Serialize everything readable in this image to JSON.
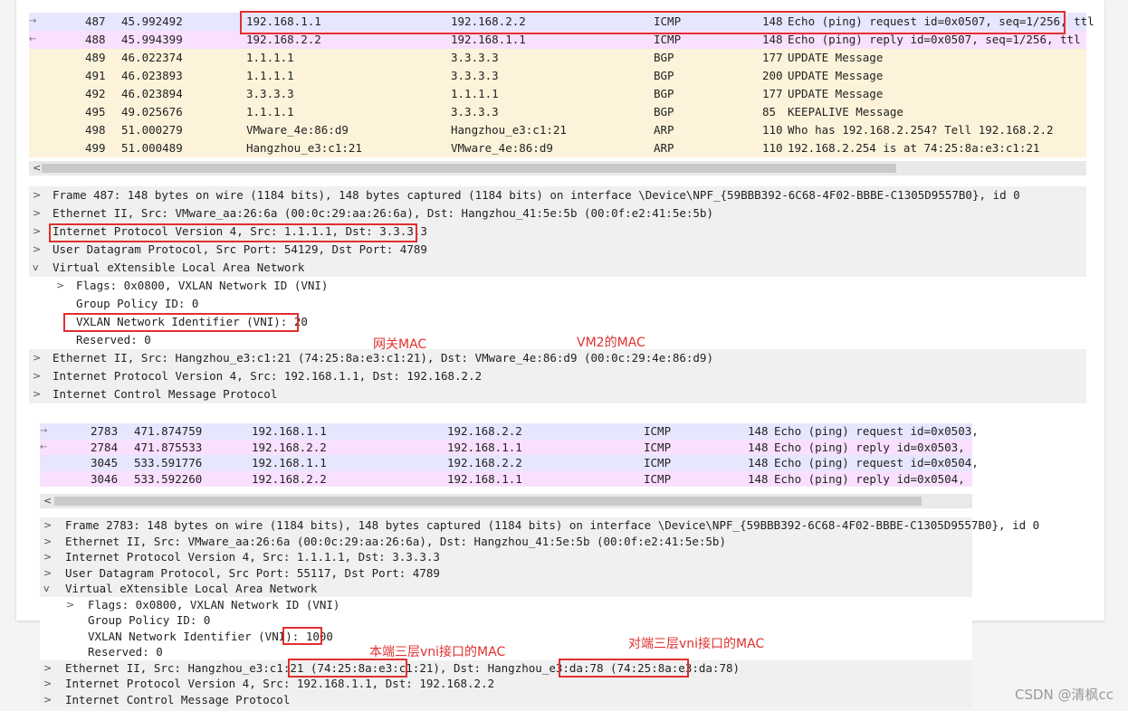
{
  "colors": {
    "icmp_row": "#e7e6ff",
    "icmp_reply_row": "#fae0ff",
    "bgp_row": "#fdf3da",
    "arp_row": "#fdf3da",
    "annotation": "#e03030"
  },
  "top": {
    "packets": [
      {
        "no": "487",
        "time": "45.992492",
        "src": "192.168.1.1",
        "dst": "192.168.2.2",
        "proto": "ICMP",
        "len": "148",
        "info": "Echo (ping) request  id=0x0507, seq=1/256, ttl",
        "arrow": "→"
      },
      {
        "no": "488",
        "time": "45.994399",
        "src": "192.168.2.2",
        "dst": "192.168.1.1",
        "proto": "ICMP",
        "len": "148",
        "info": "Echo (ping) reply    id=0x0507, seq=1/256, ttl",
        "arrow": "←"
      },
      {
        "no": "489",
        "time": "46.022374",
        "src": "1.1.1.1",
        "dst": "3.3.3.3",
        "proto": "BGP",
        "len": "177",
        "info": "UPDATE Message",
        "arrow": ""
      },
      {
        "no": "491",
        "time": "46.023893",
        "src": "1.1.1.1",
        "dst": "3.3.3.3",
        "proto": "BGP",
        "len": "200",
        "info": "UPDATE Message",
        "arrow": ""
      },
      {
        "no": "492",
        "time": "46.023894",
        "src": "3.3.3.3",
        "dst": "1.1.1.1",
        "proto": "BGP",
        "len": "177",
        "info": "UPDATE Message",
        "arrow": ""
      },
      {
        "no": "495",
        "time": "49.025676",
        "src": "1.1.1.1",
        "dst": "3.3.3.3",
        "proto": "BGP",
        "len": "85",
        "info": "KEEPALIVE Message",
        "arrow": ""
      },
      {
        "no": "498",
        "time": "51.000279",
        "src": "VMware_4e:86:d9",
        "dst": "Hangzhou_e3:c1:21",
        "proto": "ARP",
        "len": "110",
        "info": "Who has 192.168.2.254? Tell 192.168.2.2",
        "arrow": ""
      },
      {
        "no": "499",
        "time": "51.000489",
        "src": "Hangzhou_e3:c1:21",
        "dst": "VMware_4e:86:d9",
        "proto": "ARP",
        "len": "110",
        "info": "192.168.2.254 is at 74:25:8a:e3:c1:21",
        "arrow": ""
      }
    ],
    "scroll_left": "<",
    "details": [
      {
        "toggle": ">",
        "indent": 0,
        "text": "Frame 487: 148 bytes on wire (1184 bits), 148 bytes captured (1184 bits) on interface \\Device\\NPF_{59BBB392-6C68-4F02-BBBE-C1305D9557B0}, id 0"
      },
      {
        "toggle": ">",
        "indent": 0,
        "text": "Ethernet II, Src: VMware_aa:26:6a (00:0c:29:aa:26:6a), Dst: Hangzhou_41:5e:5b (00:0f:e2:41:5e:5b)"
      },
      {
        "toggle": ">",
        "indent": 0,
        "text": "Internet Protocol Version 4, Src: 1.1.1.1, Dst: 3.3.3.3"
      },
      {
        "toggle": ">",
        "indent": 0,
        "text": "User Datagram Protocol, Src Port: 54129, Dst Port: 4789"
      },
      {
        "toggle": "v",
        "indent": 0,
        "text": "Virtual eXtensible Local Area Network"
      },
      {
        "toggle": ">",
        "indent": 1,
        "text": "Flags: 0x0800, VXLAN Network ID (VNI)"
      },
      {
        "toggle": "",
        "indent": 1,
        "text": "Group Policy ID: 0"
      },
      {
        "toggle": "",
        "indent": 1,
        "text": "VXLAN Network Identifier (VNI): 20"
      },
      {
        "toggle": "",
        "indent": 1,
        "text": "Reserved: 0"
      },
      {
        "toggle": ">",
        "indent": 0,
        "text": "Ethernet II, Src: Hangzhou_e3:c1:21 (74:25:8a:e3:c1:21), Dst: VMware_4e:86:d9 (00:0c:29:4e:86:d9)"
      },
      {
        "toggle": ">",
        "indent": 0,
        "text": "Internet Protocol Version 4, Src: 192.168.1.1, Dst: 192.168.2.2"
      },
      {
        "toggle": ">",
        "indent": 0,
        "text": "Internet Control Message Protocol"
      }
    ],
    "notes": {
      "gateway_mac": "网关MAC",
      "vm2_mac": "VM2的MAC"
    }
  },
  "bottom": {
    "packets": [
      {
        "no": "2783",
        "time": "471.874759",
        "src": "192.168.1.1",
        "dst": "192.168.2.2",
        "proto": "ICMP",
        "len": "148",
        "info": "Echo (ping) request  id=0x0503,",
        "arrow": "→"
      },
      {
        "no": "2784",
        "time": "471.875533",
        "src": "192.168.2.2",
        "dst": "192.168.1.1",
        "proto": "ICMP",
        "len": "148",
        "info": "Echo (ping) reply    id=0x0503,",
        "arrow": "←"
      },
      {
        "no": "3045",
        "time": "533.591776",
        "src": "192.168.1.1",
        "dst": "192.168.2.2",
        "proto": "ICMP",
        "len": "148",
        "info": "Echo (ping) request  id=0x0504,",
        "arrow": ""
      },
      {
        "no": "3046",
        "time": "533.592260",
        "src": "192.168.2.2",
        "dst": "192.168.1.1",
        "proto": "ICMP",
        "len": "148",
        "info": "Echo (ping) reply    id=0x0504,",
        "arrow": ""
      }
    ],
    "scroll_left": "<",
    "details": [
      {
        "toggle": ">",
        "indent": 0,
        "text": "Frame 2783: 148 bytes on wire (1184 bits), 148 bytes captured (1184 bits) on interface \\Device\\NPF_{59BBB392-6C68-4F02-BBBE-C1305D9557B0}, id 0"
      },
      {
        "toggle": ">",
        "indent": 0,
        "text": "Ethernet II, Src: VMware_aa:26:6a (00:0c:29:aa:26:6a), Dst: Hangzhou_41:5e:5b (00:0f:e2:41:5e:5b)"
      },
      {
        "toggle": ">",
        "indent": 0,
        "text": "Internet Protocol Version 4, Src: 1.1.1.1, Dst: 3.3.3.3"
      },
      {
        "toggle": ">",
        "indent": 0,
        "text": "User Datagram Protocol, Src Port: 55117, Dst Port: 4789"
      },
      {
        "toggle": "v",
        "indent": 0,
        "text": "Virtual eXtensible Local Area Network"
      },
      {
        "toggle": ">",
        "indent": 1,
        "text": "Flags: 0x0800, VXLAN Network ID (VNI)"
      },
      {
        "toggle": "",
        "indent": 1,
        "text": "Group Policy ID: 0"
      },
      {
        "toggle": "",
        "indent": 1,
        "text": "VXLAN Network Identifier (VNI): 1000"
      },
      {
        "toggle": "",
        "indent": 1,
        "text": "Reserved: 0"
      },
      {
        "toggle": ">",
        "indent": 0,
        "text": "Ethernet II, Src: Hangzhou_e3:c1:21 (74:25:8a:e3:c1:21), Dst: Hangzhou_e3:da:78 (74:25:8a:e3:da:78)"
      },
      {
        "toggle": ">",
        "indent": 0,
        "text": "Internet Protocol Version 4, Src: 192.168.1.1, Dst: 192.168.2.2"
      },
      {
        "toggle": ">",
        "indent": 0,
        "text": "Internet Control Message Protocol"
      }
    ],
    "notes": {
      "local_mac": "本端三层vni接口的MAC",
      "remote_mac": "对端三层vni接口的MAC"
    }
  },
  "watermark": "CSDN @清枫cc"
}
